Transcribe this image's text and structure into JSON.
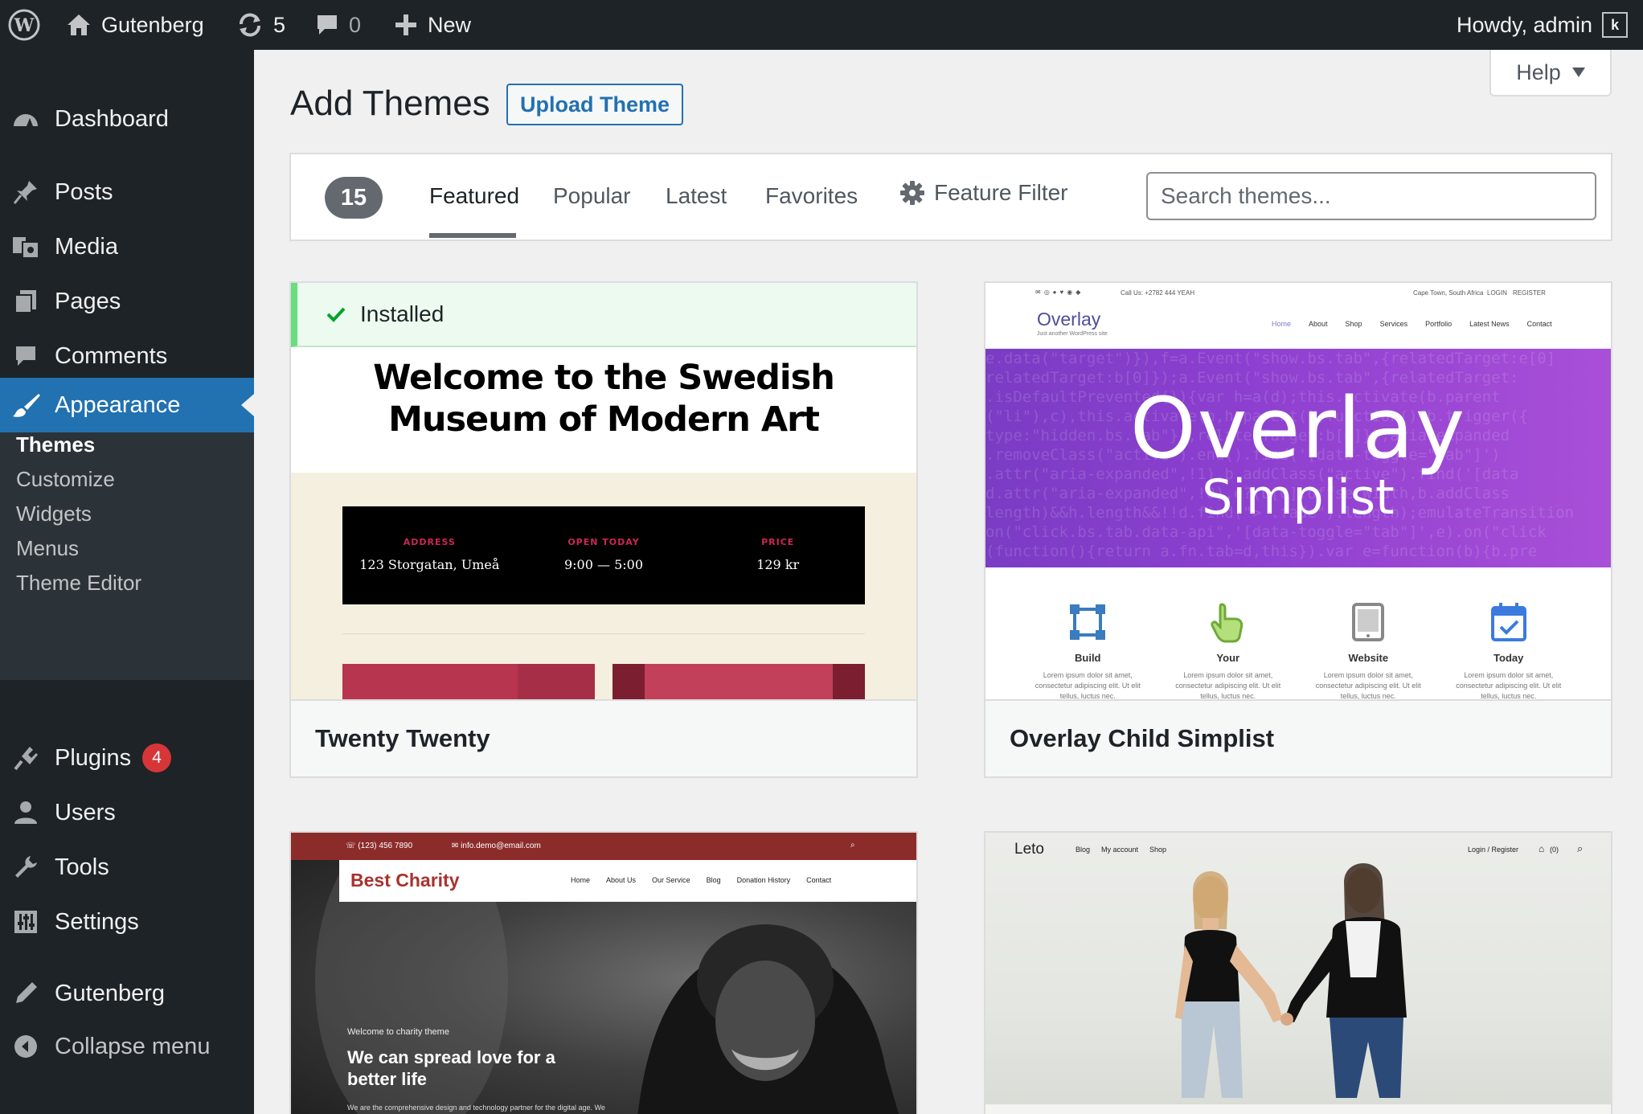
{
  "admin_bar": {
    "site_name": "Gutenberg",
    "updates_count": "5",
    "comments_count": "0",
    "new_label": "New",
    "howdy": "Howdy, admin"
  },
  "sidebar": {
    "dashboard": "Dashboard",
    "posts": "Posts",
    "media": "Media",
    "pages": "Pages",
    "comments": "Comments",
    "appearance": "Appearance",
    "submenu": {
      "themes": "Themes",
      "customize": "Customize",
      "widgets": "Widgets",
      "menus": "Menus",
      "theme_editor": "Theme Editor"
    },
    "plugins": "Plugins",
    "plugins_badge": "4",
    "users": "Users",
    "tools": "Tools",
    "settings": "Settings",
    "gutenberg": "Gutenberg",
    "collapse": "Collapse menu"
  },
  "header": {
    "help": "Help",
    "title": "Add Themes",
    "upload_button": "Upload Theme"
  },
  "filter": {
    "count": "15",
    "tabs": {
      "featured": "Featured",
      "popular": "Popular",
      "latest": "Latest",
      "favorites": "Favorites"
    },
    "feature_filter": "Feature Filter",
    "search_placeholder": "Search themes..."
  },
  "themes": {
    "twenty_twenty": {
      "name": "Twenty Twenty",
      "installed_label": "Installed",
      "preview": {
        "heading_line1": "Welcome to the Swedish",
        "heading_line2": "Museum of Modern Art",
        "address_label": "ADDRESS",
        "address_value": "123 Storgatan, Umeå",
        "open_label": "OPEN TODAY",
        "open_value": "9:00 — 5:00",
        "price_label": "PRICE",
        "price_value": "129 kr"
      }
    },
    "overlay": {
      "name": "Overlay Child Simplist",
      "preview": {
        "top_phone": "Call Us: +2782 444 YEAH",
        "top_location": "Cape Town, South Africa",
        "top_login": "LOGIN",
        "top_register": "REGISTER",
        "logo": "Overlay",
        "tagline": "Just another WordPress site",
        "menu": [
          "Home",
          "About",
          "Shop",
          "Services",
          "Portfolio",
          "Latest News",
          "Contact"
        ],
        "hero_title": "Overlay",
        "hero_subtitle": "Simplist",
        "features": [
          "Build",
          "Your",
          "Website",
          "Today"
        ],
        "feature_text": "Lorem ipsum dolor sit amet, consectetur adipiscing elit. Ut elit tellus, luctus nec."
      }
    },
    "best_charity": {
      "preview": {
        "phone": "(123) 456 7890",
        "email": "info.demo@email.com",
        "logo": "Best Charity",
        "menu": [
          "Home",
          "About Us",
          "Our Service",
          "Blog",
          "Donation History",
          "Contact"
        ],
        "welcome": "Welcome to charity theme",
        "headline": "We can spread love for a better life",
        "description": "We are the comprehensive design and technology partner for the digital age. We help businesses to stay relevant to their customers"
      }
    },
    "leto": {
      "preview": {
        "logo": "Leto",
        "menu": [
          "Blog",
          "My account",
          "Shop"
        ],
        "login": "Login / Register",
        "cart": "(0)"
      }
    }
  },
  "colors": {
    "adminbar_bg": "#1d2327",
    "accent": "#2271b1",
    "installed_green": "#68de7c",
    "badge_red": "#d63638"
  }
}
